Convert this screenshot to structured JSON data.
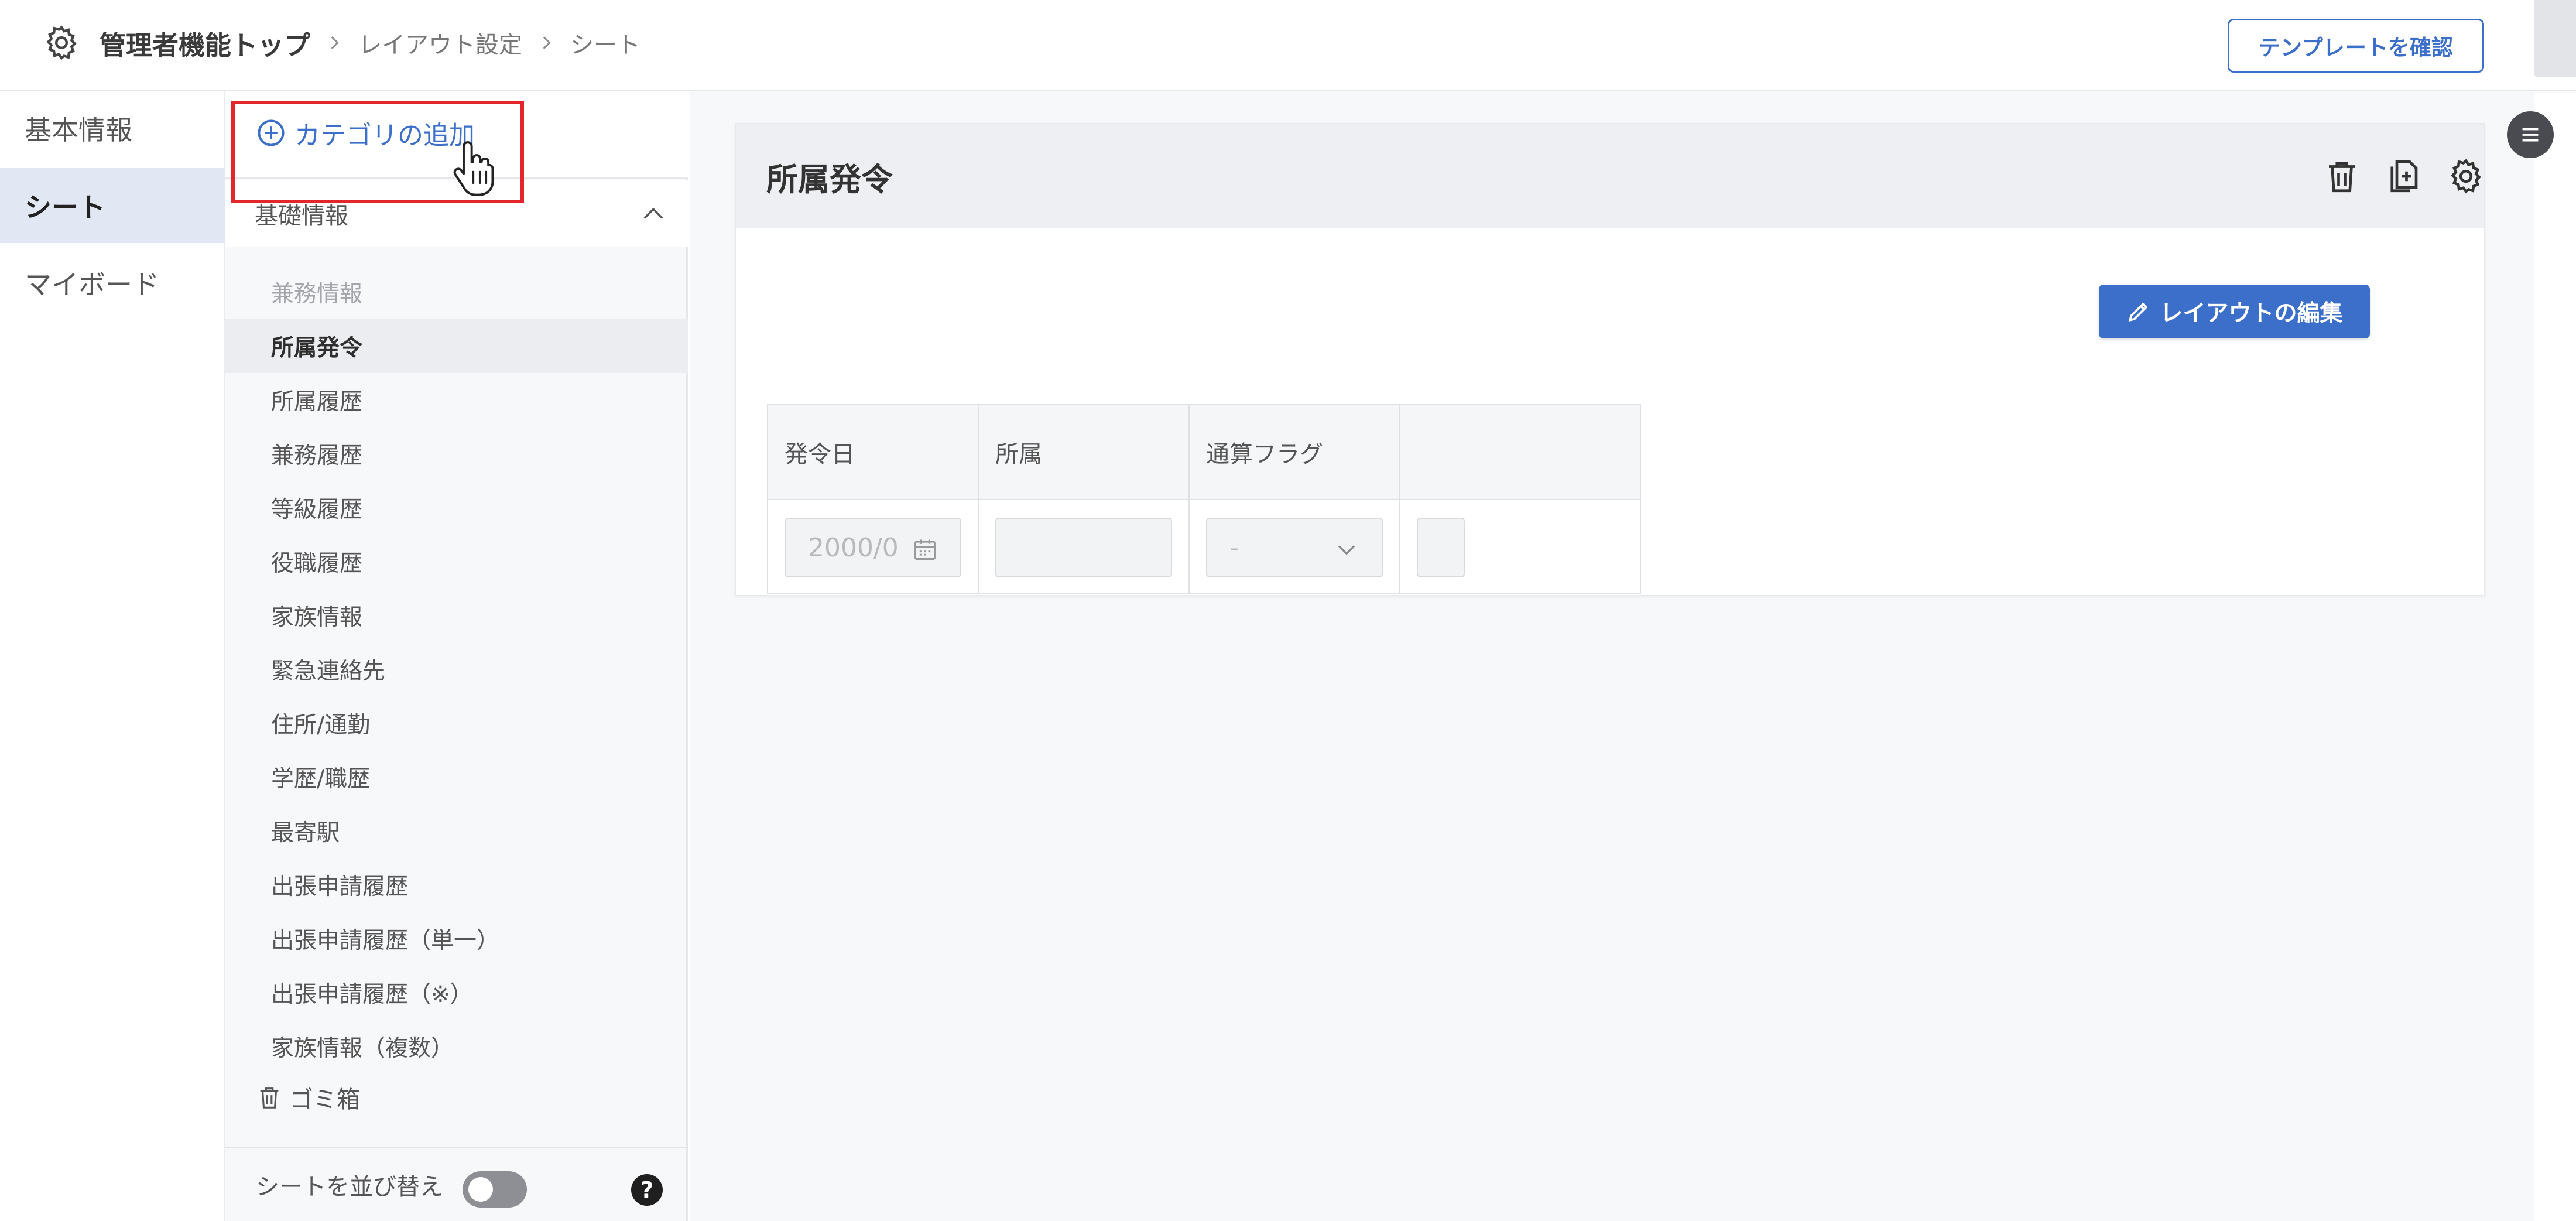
{
  "breadcrumb": {
    "root": "管理者機能トップ",
    "level1": "レイアウト設定",
    "level2": "シート"
  },
  "header": {
    "template_button": "テンプレートを確認"
  },
  "leftnav": {
    "items": [
      {
        "label": "基本情報"
      },
      {
        "label": "シート"
      },
      {
        "label": "マイボード"
      }
    ]
  },
  "categories": {
    "add_label": "カテゴリの追加",
    "group_label": "基礎情報",
    "items": [
      {
        "label": "兼務情報"
      },
      {
        "label": "所属発令"
      },
      {
        "label": "所属履歴"
      },
      {
        "label": "兼務履歴"
      },
      {
        "label": "等級履歴"
      },
      {
        "label": "役職履歴"
      },
      {
        "label": "家族情報"
      },
      {
        "label": "緊急連絡先"
      },
      {
        "label": "住所/通勤"
      },
      {
        "label": "学歴/職歴"
      },
      {
        "label": "最寄駅"
      },
      {
        "label": "出張申請履歴"
      },
      {
        "label": "出張申請履歴（単一）"
      },
      {
        "label": "出張申請履歴（※）"
      },
      {
        "label": "家族情報（複数）"
      }
    ],
    "trash_label": "ゴミ箱",
    "sort_label": "シートを並び替え",
    "help_glyph": "?"
  },
  "sheet": {
    "title": "所属発令",
    "edit_button": "レイアウトの編集",
    "columns": [
      "発令日",
      "所属",
      "通算フラグ",
      ""
    ],
    "row": {
      "date_placeholder": "2000/0",
      "select_value": "-"
    }
  },
  "colors": {
    "accent": "#3b6fc9",
    "highlight": "#e3262c",
    "selected_nav": "#e2e7f4"
  }
}
